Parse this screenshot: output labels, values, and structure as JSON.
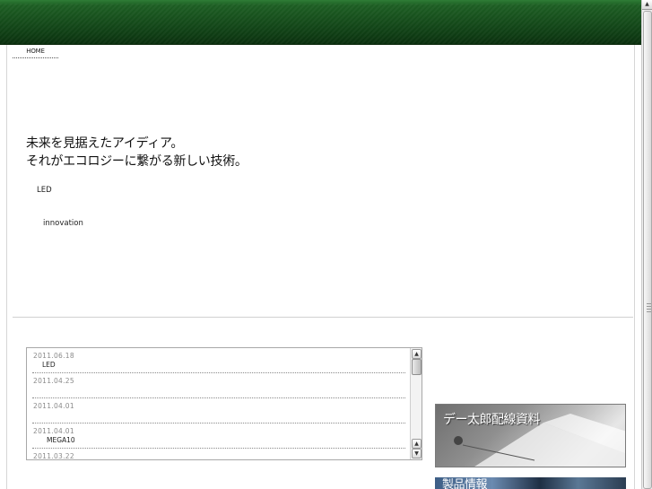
{
  "nav": {
    "home_label": "HOME"
  },
  "hero": {
    "line1": "未来を見据えたアイディア。",
    "line2": "それがエコロジーに繋がる新しい技術。",
    "sub1": "LED",
    "sub2": "innovation"
  },
  "news": {
    "items": [
      {
        "date": "2011.06.18",
        "title": "LED"
      },
      {
        "date": "2011.04.25",
        "title": ""
      },
      {
        "date": "2011.04.01",
        "title": ""
      },
      {
        "date": "2011.04.01",
        "title": "MEGA10"
      },
      {
        "date": "2011.03.22",
        "title": ""
      }
    ]
  },
  "banners": {
    "wiring": {
      "label": "デー太郎配線資料"
    },
    "second": {
      "label": "製品情報"
    }
  },
  "scroll": {
    "up_glyph": "▲",
    "down_glyph": "▼"
  },
  "colors": {
    "header_green": "#1d5e23",
    "divider": "#d0d0d0"
  }
}
